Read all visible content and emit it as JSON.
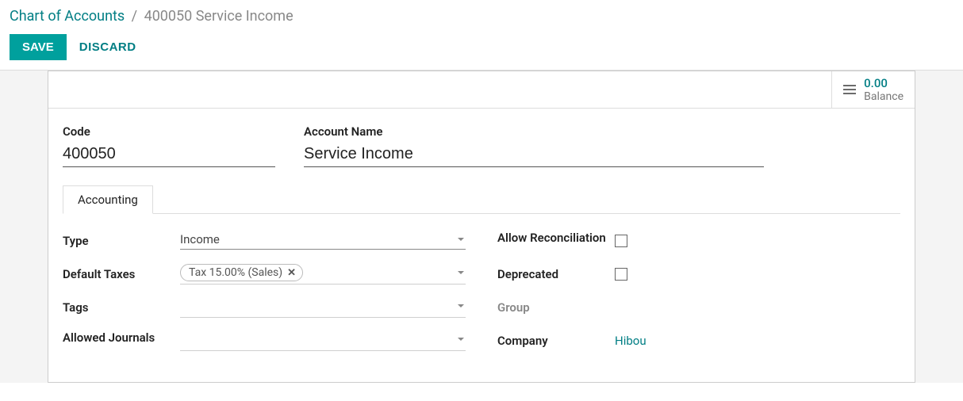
{
  "breadcrumb": {
    "parent": "Chart of Accounts",
    "separator": "/",
    "current": "400050 Service Income"
  },
  "actions": {
    "save": "SAVE",
    "discard": "DISCARD"
  },
  "stat": {
    "value": "0.00",
    "label": "Balance"
  },
  "header_fields": {
    "code_label": "Code",
    "code_value": "400050",
    "name_label": "Account Name",
    "name_value": "Service Income"
  },
  "tabs": {
    "accounting": "Accounting"
  },
  "fields_left": {
    "type_label": "Type",
    "type_value": "Income",
    "default_taxes_label": "Default Taxes",
    "tax_tag": "Tax 15.00% (Sales)",
    "tags_label": "Tags",
    "allowed_journals_label": "Allowed Journals"
  },
  "fields_right": {
    "allow_recon_label": "Allow Reconciliation",
    "deprecated_label": "Deprecated",
    "group_label": "Group",
    "company_label": "Company",
    "company_value": "Hibou"
  }
}
